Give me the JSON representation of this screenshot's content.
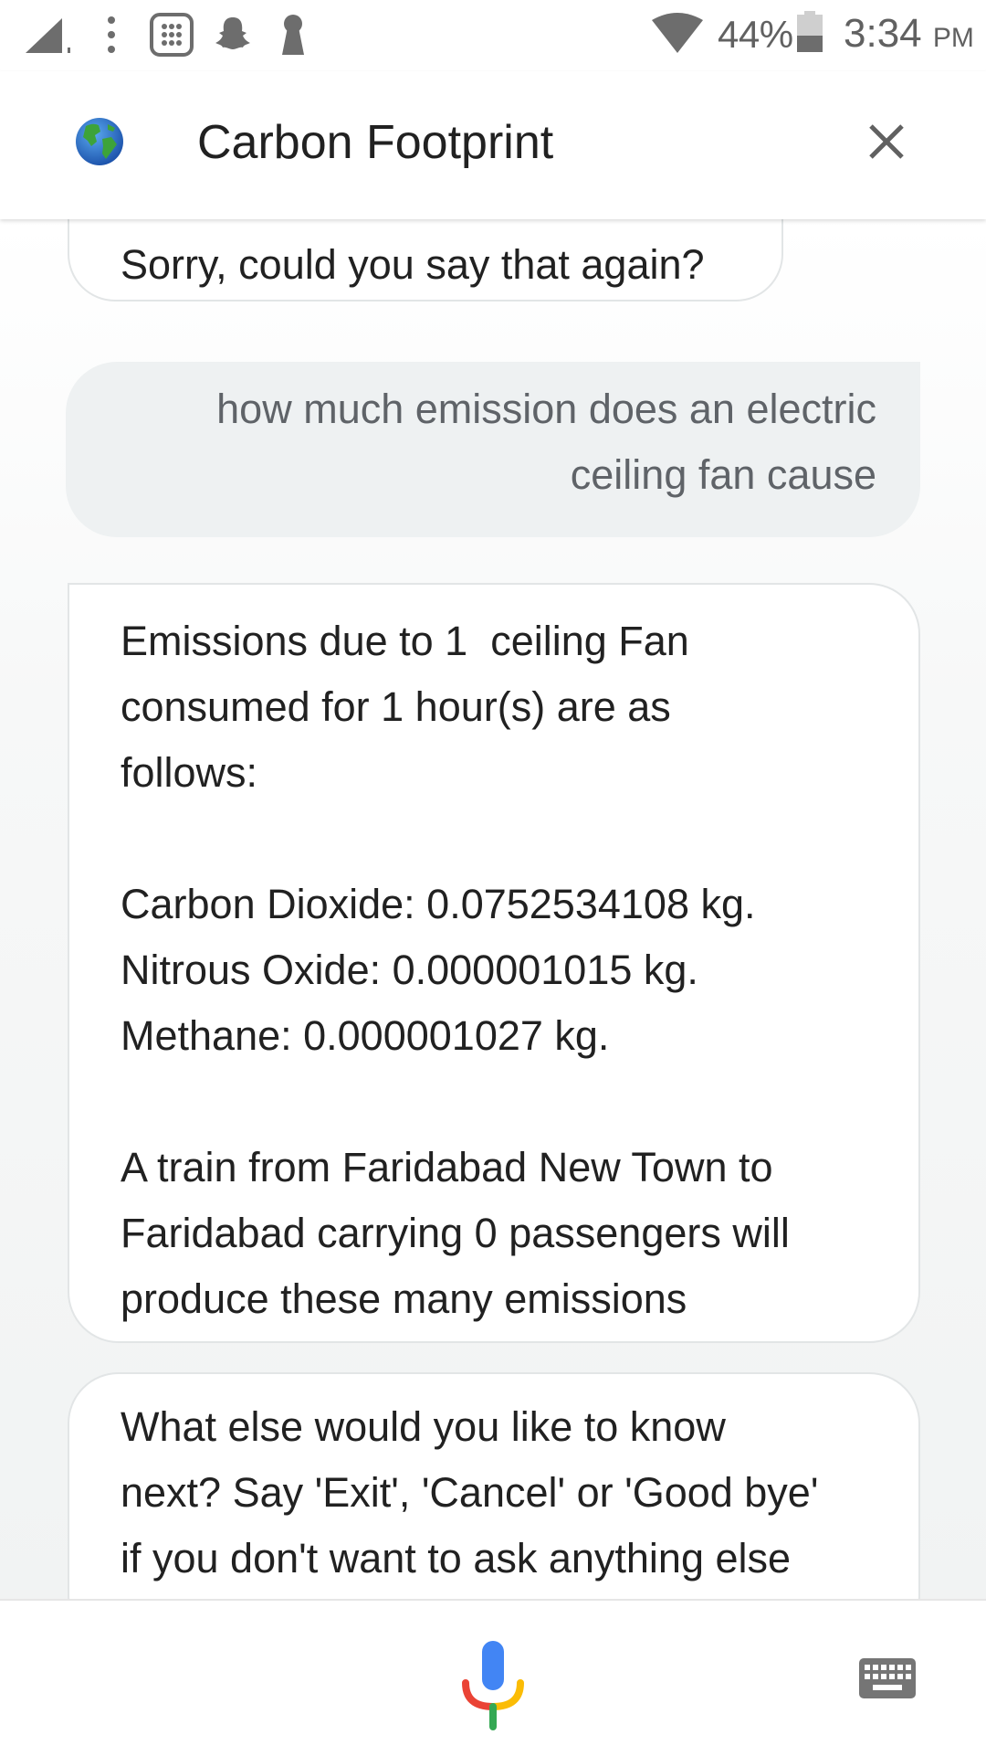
{
  "status_bar": {
    "battery_percent": "44%",
    "time": "3:34",
    "am_pm": "PM",
    "icons": [
      "signal-icon",
      "more-vert-icon",
      "dialer-icon",
      "snapchat-icon",
      "keyhole-icon",
      "wifi-icon",
      "battery-icon"
    ],
    "battery_level": 0.44
  },
  "header": {
    "title": "Carbon Footprint",
    "icon": "globe-icon",
    "close_icon": "close-icon"
  },
  "conversation": {
    "messages": [
      {
        "sender": "bot",
        "text": "Sorry, could you say that again?"
      },
      {
        "sender": "user",
        "text": "how much emission does an electric\nceiling fan cause"
      },
      {
        "sender": "bot",
        "text": "Emissions due to 1  ceiling Fan\nconsumed for 1 hour(s) are as\nfollows:\n\nCarbon Dioxide: 0.0752534108 kg.\nNitrous Oxide: 0.000001015 kg.\nMethane: 0.000001027 kg.\n\nA train from Faridabad New Town to\nFaridabad carrying 0 passengers will\nproduce these many emissions"
      },
      {
        "sender": "bot",
        "text": "What else would you like to know\nnext? Say 'Exit', 'Cancel' or 'Good bye'\nif you don't want to ask anything else"
      }
    ]
  },
  "bottom_bar": {
    "mic_icon": "mic-icon",
    "keyboard_icon": "keyboard-icon"
  },
  "colors": {
    "user_bubble_bg": "#eef1f2",
    "bot_bubble_border": "#e2e5e6",
    "mic_blue": "#4285F4",
    "mic_red": "#EA4335",
    "mic_yellow": "#FBBC05",
    "mic_green": "#34A853"
  }
}
